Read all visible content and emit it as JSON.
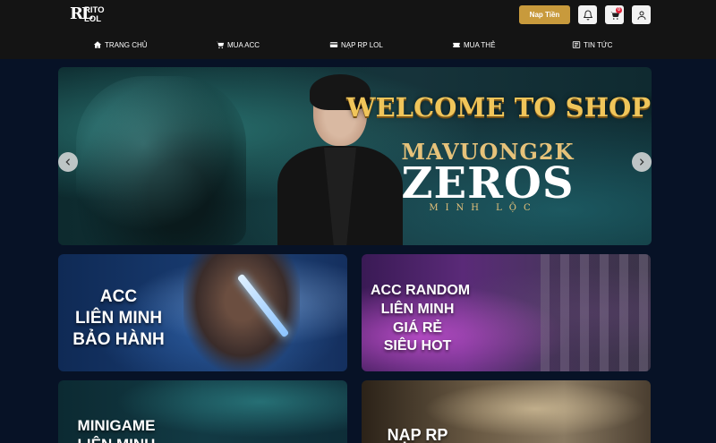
{
  "header": {
    "logo_text": "RITO\nLOL",
    "logo_mark": "RL",
    "nap_button": "Nap Tiền",
    "cart_badge": "0",
    "icons": [
      "bell-icon",
      "cart-icon",
      "user-icon"
    ]
  },
  "nav": {
    "items": [
      {
        "label": "TRANG CHỦ",
        "icon": "home-icon"
      },
      {
        "label": "MUA ACC",
        "icon": "cart-icon"
      },
      {
        "label": "NẠP RP LOL",
        "icon": "card-icon"
      },
      {
        "label": "MUA THẺ",
        "icon": "ticket-icon"
      },
      {
        "label": "TIN TỨC",
        "icon": "news-icon"
      }
    ]
  },
  "hero": {
    "welcome": "WELCOME TO SHOPRITO",
    "subtitle": "MAVUONG2K",
    "title": "ZEROS",
    "tagline": "MINH LỘC"
  },
  "cards": [
    {
      "lines": [
        "ACC",
        "LIÊN MINH",
        "BẢO HÀNH"
      ]
    },
    {
      "lines": [
        "ACC RANDOM",
        "LIÊN MINH",
        "GIÁ RẺ",
        "SIÊU HOT"
      ]
    },
    {
      "lines": [
        "MINIGAME",
        "LIÊN MINH"
      ]
    },
    {
      "lines": [
        "NẠP RP"
      ]
    }
  ],
  "colors": {
    "background": "#071226",
    "header": "#141414",
    "accent_gold": "#c89a3c",
    "welcome_gold": "#f0c55a"
  }
}
